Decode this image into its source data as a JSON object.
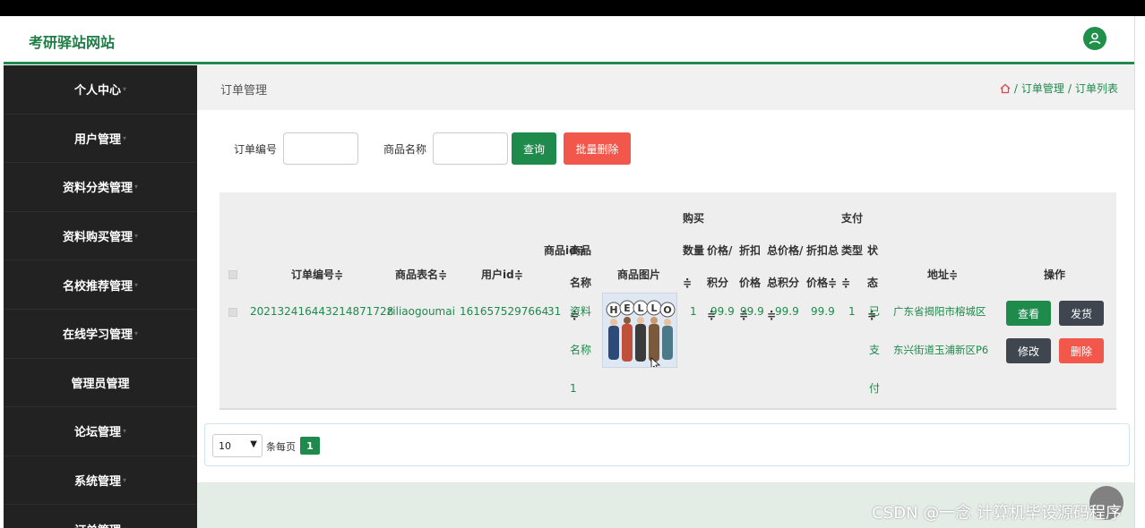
{
  "app": {
    "title": "考研驿站网站"
  },
  "sidebar": {
    "items": [
      {
        "label": "个人中心"
      },
      {
        "label": "用户管理"
      },
      {
        "label": "资料分类管理"
      },
      {
        "label": "资料购买管理"
      },
      {
        "label": "名校推荐管理"
      },
      {
        "label": "在线学习管理"
      },
      {
        "label": "管理员管理"
      },
      {
        "label": "论坛管理"
      },
      {
        "label": "系统管理"
      },
      {
        "label": "订单管理"
      }
    ]
  },
  "breadcrumb": {
    "title": "订单管理",
    "items": [
      "订单管理",
      "订单列表"
    ],
    "sep": "/"
  },
  "search": {
    "order_no_label": "订单编号",
    "order_no_value": "",
    "product_name_label": "商品名称",
    "product_name_value": "",
    "query_label": "查询",
    "batch_delete_label": "批量删除"
  },
  "table": {
    "headers": {
      "order_no": "订单编号≑",
      "table_name": "商品表名≑",
      "user_id": "用户id≑",
      "product_id": "商品id≑",
      "product_name": "商品名称≑",
      "product_image": "商品图片",
      "quantity": "购买数量≑",
      "price_points": "价格/积分≑",
      "discount_price": "折扣价格≑",
      "total_price_points": "总价格/总积分≑",
      "discount_total_price": "折扣总价格≑",
      "pay_type": "支付类型≑",
      "status": "状态≑",
      "address": "地址≑",
      "actions": "操作"
    },
    "rows": [
      {
        "order_no": "202132416443214871728",
        "table_name": "ziliaogoumai",
        "user_id": "1616575297664",
        "product_id": "31",
        "product_name": "资料名称1",
        "product_image_text": "HELLO",
        "quantity": "1",
        "price_points": "99.9",
        "discount_price": "99.9",
        "total_price_points": "99.9",
        "discount_total_price": "99.9",
        "pay_type": "1",
        "status": "已支付",
        "address": "广东省揭阳市榕城区东兴街道玉浦新区P6",
        "actions": {
          "view": "查看",
          "ship": "发货",
          "edit": "修改",
          "delete": "删除"
        }
      }
    ]
  },
  "pagination": {
    "page_size": "10",
    "per_page_label": "条每页",
    "current_page": "1"
  },
  "watermark": "CSDN @一念 计算机毕设源码程序",
  "colors": {
    "primary": "#1e8a4c",
    "danger": "#f2574b",
    "dark_btn": "#3f4650",
    "sidebar_bg": "#222222"
  }
}
